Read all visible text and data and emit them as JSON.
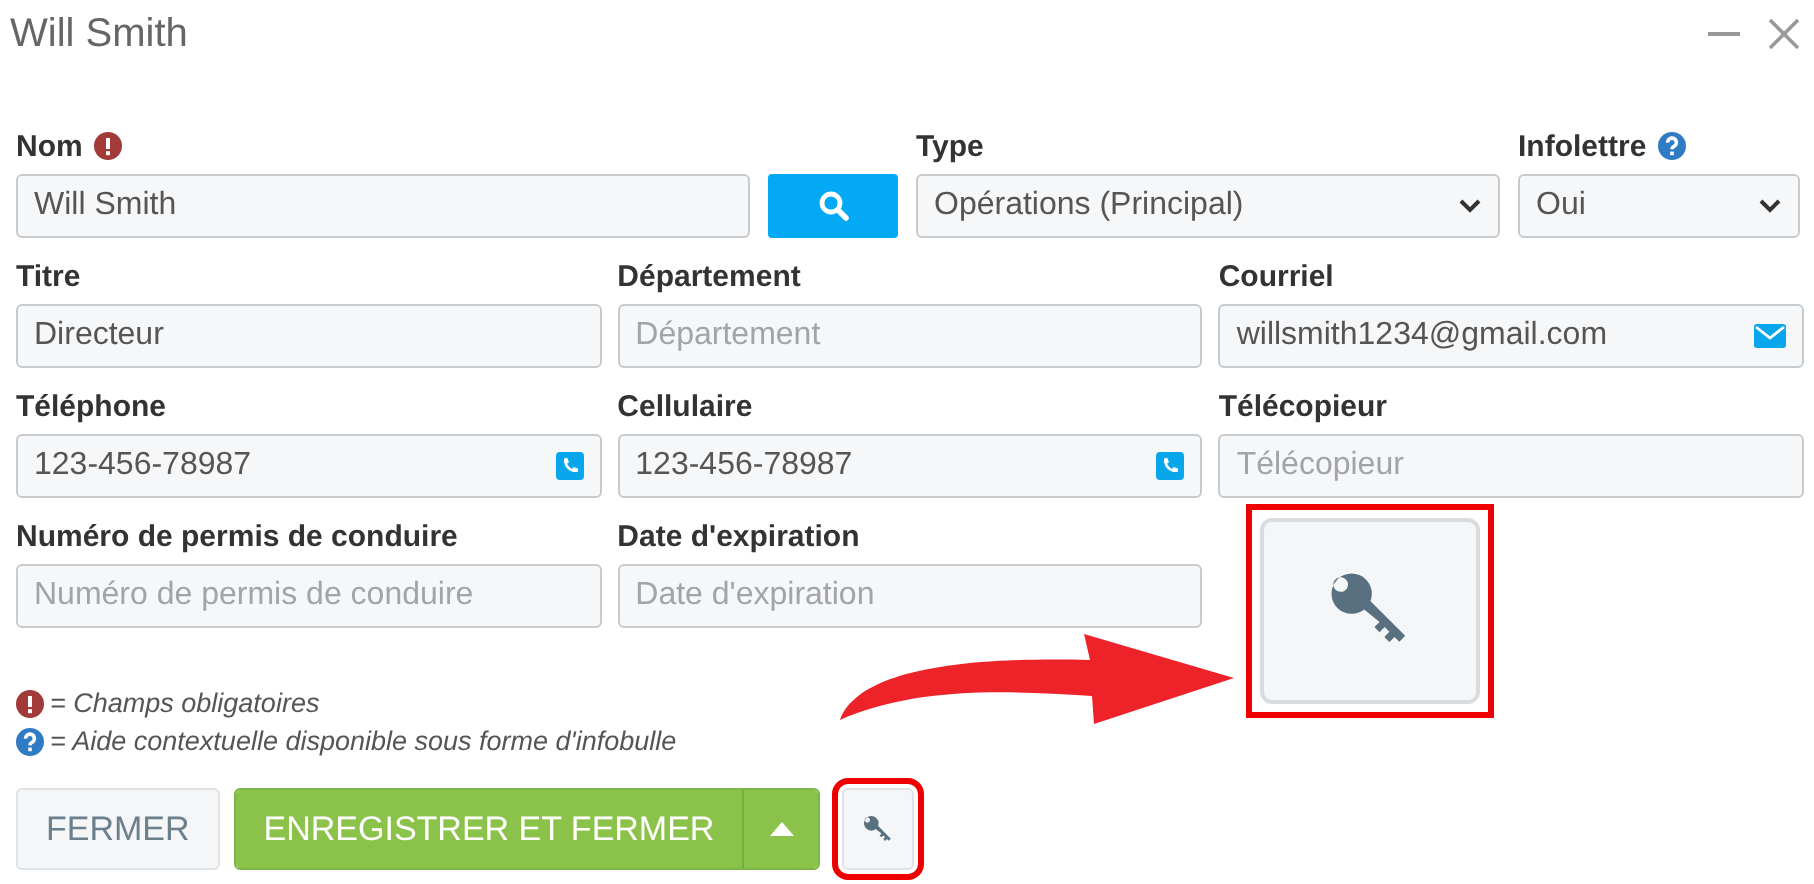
{
  "window": {
    "title": "Will Smith"
  },
  "rows": [
    [
      {
        "kind": "text",
        "label": "Nom",
        "required": true,
        "value": "Will Smith"
      },
      {
        "kind": "search"
      },
      {
        "kind": "select",
        "label": "Type",
        "value": "Opérations (Principal)"
      },
      {
        "kind": "select",
        "label": "Infolettre",
        "help": true,
        "value": "Oui"
      }
    ],
    [
      {
        "kind": "text",
        "label": "Titre",
        "value": "Directeur"
      },
      {
        "kind": "text",
        "label": "Département",
        "placeholder": "Département"
      },
      {
        "kind": "email",
        "label": "Courriel",
        "value": "willsmith1234@gmail.com"
      }
    ],
    [
      {
        "kind": "phone",
        "label": "Téléphone",
        "value": "123-456-78987"
      },
      {
        "kind": "phone",
        "label": "Cellulaire",
        "value": "123-456-78987"
      },
      {
        "kind": "text",
        "label": "Télécopieur",
        "placeholder": "Télécopieur"
      }
    ],
    [
      {
        "kind": "text",
        "label": "Numéro de permis de conduire",
        "placeholder": "Numéro de permis de conduire"
      },
      {
        "kind": "text",
        "label": "Date d'expiration",
        "placeholder": "Date d'expiration"
      }
    ]
  ],
  "legend": [
    {
      "kind": "required",
      "text": "= Champs obligatoires"
    },
    {
      "kind": "help",
      "text": "= Aide contextuelle disponible sous forme d'infobulle"
    }
  ],
  "buttons": [
    {
      "kind": "secondary",
      "label": "FERMER"
    },
    {
      "kind": "primary",
      "label": "ENREGISTRER ET FERMER"
    },
    {
      "kind": "key",
      "highlighted": true
    }
  ],
  "annotation": {
    "kind": "arrow-callout"
  }
}
